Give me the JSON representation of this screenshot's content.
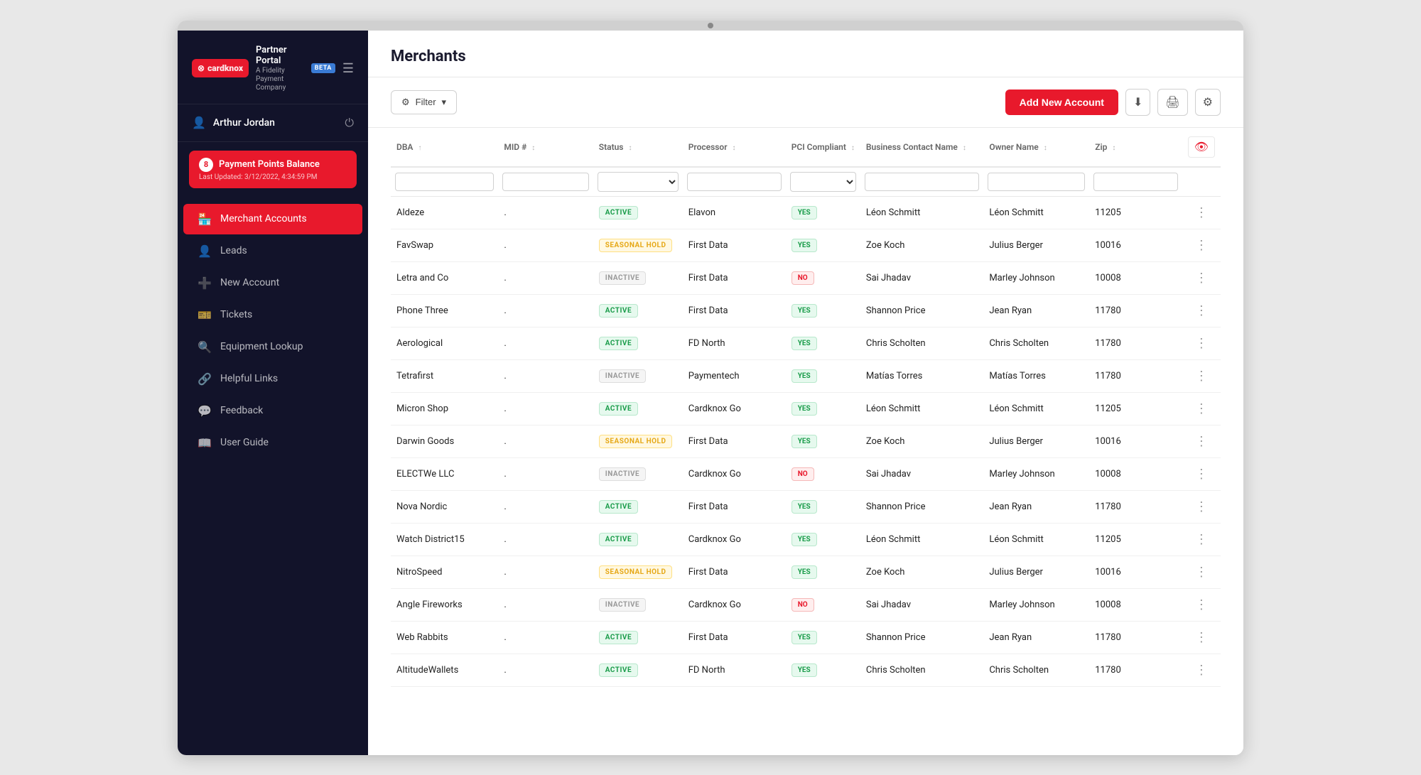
{
  "app": {
    "logo_text": "cardknox",
    "portal_label": "Partner",
    "portal_sub": "Portal",
    "a_fidelity": "A Fidelity Payment Company",
    "beta": "BETA"
  },
  "sidebar": {
    "user_name": "Arthur Jordan",
    "points_count": "8",
    "points_label": "Payment Points Balance",
    "points_updated": "Last Updated: 3/12/2022, 4:34:59 PM",
    "nav_items": [
      {
        "id": "merchant-accounts",
        "label": "Merchant Accounts",
        "icon": "🏪",
        "active": true
      },
      {
        "id": "leads",
        "label": "Leads",
        "icon": "👤",
        "active": false
      },
      {
        "id": "new-account",
        "label": "New Account",
        "icon": "➕",
        "active": false
      },
      {
        "id": "tickets",
        "label": "Tickets",
        "icon": "🎫",
        "active": false
      },
      {
        "id": "equipment-lookup",
        "label": "Equipment Lookup",
        "icon": "🔍",
        "active": false
      },
      {
        "id": "helpful-links",
        "label": "Helpful Links",
        "icon": "🔗",
        "active": false
      },
      {
        "id": "feedback",
        "label": "Feedback",
        "icon": "💬",
        "active": false
      },
      {
        "id": "user-guide",
        "label": "User Guide",
        "icon": "📖",
        "active": false
      }
    ]
  },
  "main": {
    "page_title": "Merchants",
    "filter_label": "Filter",
    "add_account_label": "Add New Account",
    "table": {
      "columns": [
        {
          "id": "dba",
          "label": "DBA"
        },
        {
          "id": "mid",
          "label": "MID #"
        },
        {
          "id": "status",
          "label": "Status"
        },
        {
          "id": "processor",
          "label": "Processor"
        },
        {
          "id": "pci",
          "label": "PCI Compliant"
        },
        {
          "id": "contact",
          "label": "Business Contact Name"
        },
        {
          "id": "owner",
          "label": "Owner Name"
        },
        {
          "id": "zip",
          "label": "Zip"
        }
      ],
      "rows": [
        {
          "dba": "Aldeze",
          "mid": ".",
          "status": "ACTIVE",
          "processor": "Elavon",
          "pci": "YES",
          "contact": "Léon Schmitt",
          "owner": "Léon Schmitt",
          "zip": "11205"
        },
        {
          "dba": "FavSwap",
          "mid": ".",
          "status": "SEASONAL HOLD",
          "processor": "First Data",
          "pci": "YES",
          "contact": "Zoe Koch",
          "owner": "Julius Berger",
          "zip": "10016"
        },
        {
          "dba": "Letra and Co",
          "mid": ".",
          "status": "INACTIVE",
          "processor": "First Data",
          "pci": "NO",
          "contact": "Sai Jhadav",
          "owner": "Marley Johnson",
          "zip": "10008"
        },
        {
          "dba": "Phone Three",
          "mid": ".",
          "status": "ACTIVE",
          "processor": "First Data",
          "pci": "YES",
          "contact": "Shannon Price",
          "owner": "Jean Ryan",
          "zip": "11780"
        },
        {
          "dba": "Aerological",
          "mid": ".",
          "status": "ACTIVE",
          "processor": "FD North",
          "pci": "YES",
          "contact": "Chris Scholten",
          "owner": "Chris Scholten",
          "zip": "11780"
        },
        {
          "dba": "Tetrafirst",
          "mid": ".",
          "status": "INACTIVE",
          "processor": "Paymentech",
          "pci": "YES",
          "contact": "Matías Torres",
          "owner": "Matías Torres",
          "zip": "11780"
        },
        {
          "dba": "Micron Shop",
          "mid": ".",
          "status": "ACTIVE",
          "processor": "Cardknox Go",
          "pci": "YES",
          "contact": "Léon Schmitt",
          "owner": "Léon Schmitt",
          "zip": "11205"
        },
        {
          "dba": "Darwin Goods",
          "mid": ".",
          "status": "SEASONAL HOLD",
          "processor": "First Data",
          "pci": "YES",
          "contact": "Zoe Koch",
          "owner": "Julius Berger",
          "zip": "10016"
        },
        {
          "dba": "ELECTWe LLC",
          "mid": ".",
          "status": "INACTIVE",
          "processor": "Cardknox Go",
          "pci": "NO",
          "contact": "Sai Jhadav",
          "owner": "Marley Johnson",
          "zip": "10008"
        },
        {
          "dba": "Nova Nordic",
          "mid": ".",
          "status": "ACTIVE",
          "processor": "First Data",
          "pci": "YES",
          "contact": "Shannon Price",
          "owner": "Jean Ryan",
          "zip": "11780"
        },
        {
          "dba": "Watch District15",
          "mid": ".",
          "status": "ACTIVE",
          "processor": "Cardknox Go",
          "pci": "YES",
          "contact": "Léon Schmitt",
          "owner": "Léon Schmitt",
          "zip": "11205"
        },
        {
          "dba": "NitroSpeed",
          "mid": ".",
          "status": "SEASONAL HOLD",
          "processor": "First Data",
          "pci": "YES",
          "contact": "Zoe Koch",
          "owner": "Julius Berger",
          "zip": "10016"
        },
        {
          "dba": "Angle Fireworks",
          "mid": ".",
          "status": "INACTIVE",
          "processor": "Cardknox Go",
          "pci": "NO",
          "contact": "Sai Jhadav",
          "owner": "Marley Johnson",
          "zip": "10008"
        },
        {
          "dba": "Web Rabbits",
          "mid": ".",
          "status": "ACTIVE",
          "processor": "First Data",
          "pci": "YES",
          "contact": "Shannon Price",
          "owner": "Jean Ryan",
          "zip": "11780"
        },
        {
          "dba": "AltitudeWallets",
          "mid": ".",
          "status": "ACTIVE",
          "processor": "FD North",
          "pci": "YES",
          "contact": "Chris Scholten",
          "owner": "Chris Scholten",
          "zip": "11780"
        }
      ]
    }
  }
}
